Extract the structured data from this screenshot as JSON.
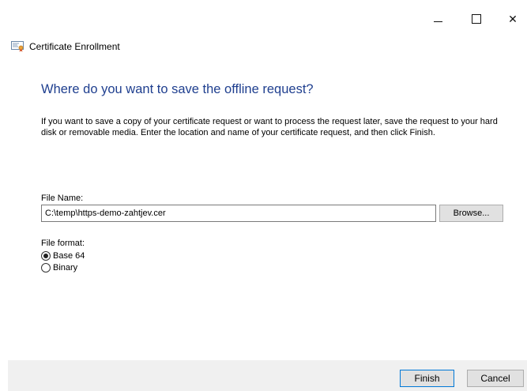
{
  "window": {
    "app_title": "Certificate Enrollment",
    "minimize_glyph": "",
    "close_glyph": "✕"
  },
  "page": {
    "heading": "Where do you want to save the offline request?",
    "description": "If you want to save a copy of your certificate request or want to process the request later, save the request to your hard disk or removable media. Enter the location and name of your certificate request, and then click Finish."
  },
  "file": {
    "label": "File Name:",
    "value": "C:\\temp\\https-demo-zahtjev.cer",
    "browse_label": "Browse..."
  },
  "format": {
    "label": "File format:",
    "options": [
      {
        "label": "Base 64",
        "selected": true
      },
      {
        "label": "Binary",
        "selected": false
      }
    ]
  },
  "footer": {
    "finish_label": "Finish",
    "cancel_label": "Cancel"
  },
  "icons": {
    "app": "certificate-icon"
  },
  "colors": {
    "heading": "#1f3f8f",
    "footer_bg": "#f0f0f0",
    "default_button_border": "#0078d7"
  }
}
